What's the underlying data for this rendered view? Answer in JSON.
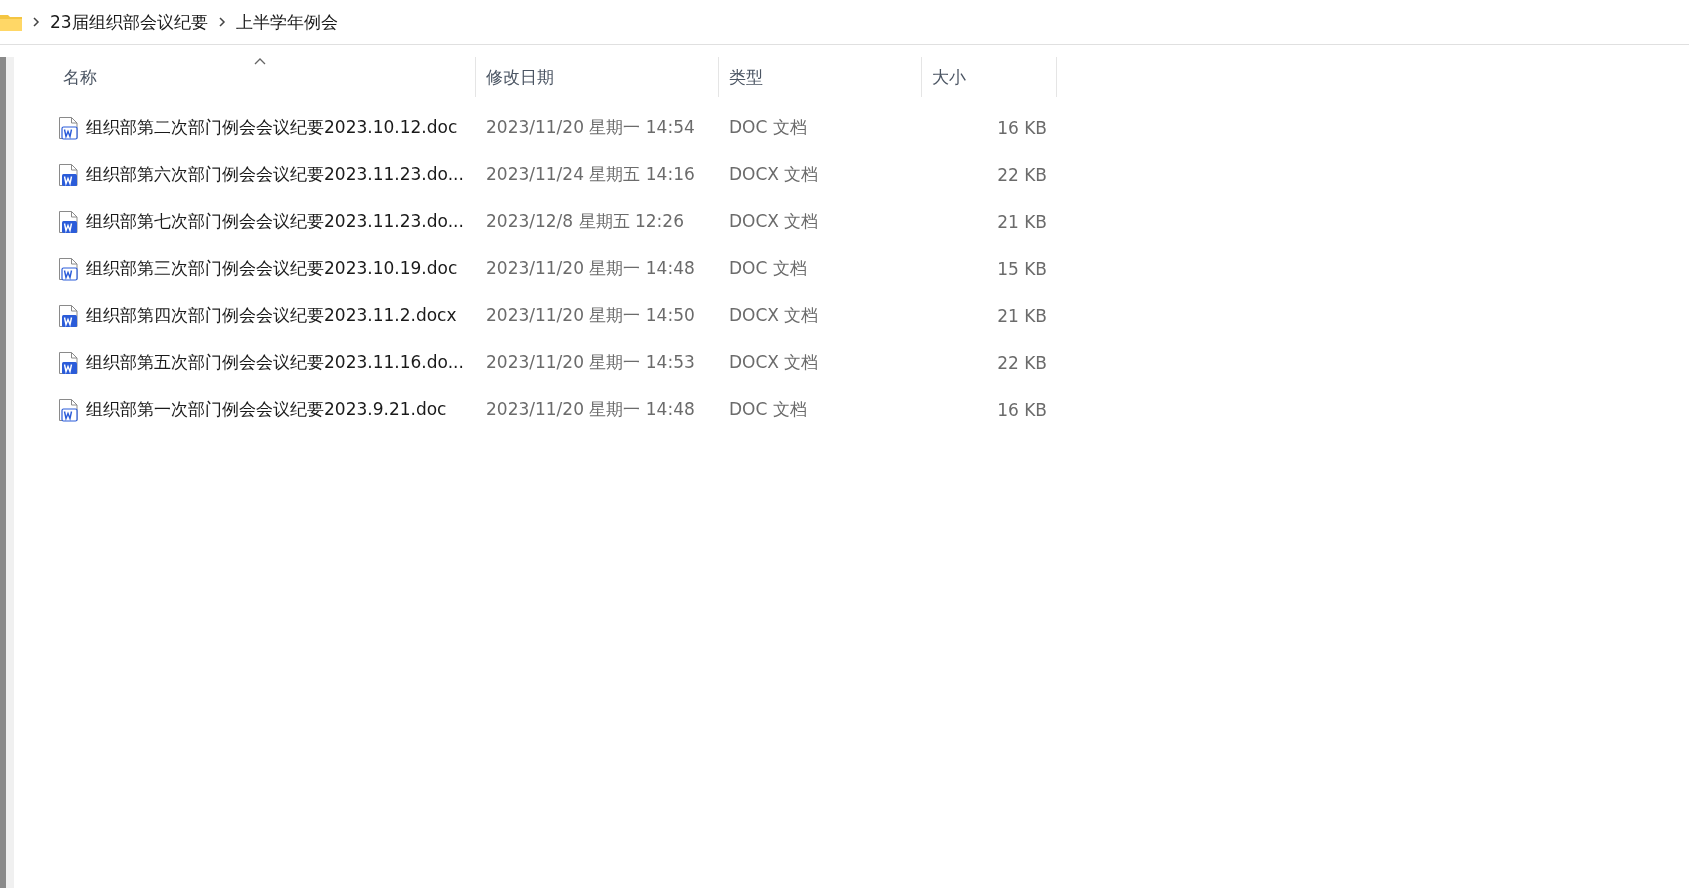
{
  "breadcrumb": [
    "23届组织部会议纪要",
    "上半学年例会"
  ],
  "table": {
    "columns": [
      "名称",
      "修改日期",
      "类型",
      "大小"
    ],
    "rows": [
      {
        "kind": "doc",
        "name": "组织部第二次部门例会会议纪要2023.10.12.doc",
        "date": "2023/11/20 星期一 14:54",
        "type": "DOC 文档",
        "size": "16 KB"
      },
      {
        "kind": "docx",
        "name": "组织部第六次部门例会会议纪要2023.11.23.do...",
        "date": "2023/11/24 星期五 14:16",
        "type": "DOCX 文档",
        "size": "22 KB"
      },
      {
        "kind": "docx",
        "name": "组织部第七次部门例会会议纪要2023.11.23.do...",
        "date": "2023/12/8 星期五 12:26",
        "type": "DOCX 文档",
        "size": "21 KB"
      },
      {
        "kind": "doc",
        "name": "组织部第三次部门例会会议纪要2023.10.19.doc",
        "date": "2023/11/20 星期一 14:48",
        "type": "DOC 文档",
        "size": "15 KB"
      },
      {
        "kind": "docx",
        "name": "组织部第四次部门例会会议纪要2023.11.2.docx",
        "date": "2023/11/20 星期一 14:50",
        "type": "DOCX 文档",
        "size": "21 KB"
      },
      {
        "kind": "docx",
        "name": "组织部第五次部门例会会议纪要2023.11.16.do...",
        "date": "2023/11/20 星期一 14:53",
        "type": "DOCX 文档",
        "size": "22 KB"
      },
      {
        "kind": "doc",
        "name": "组织部第一次部门例会会议纪要2023.9.21.doc",
        "date": "2023/11/20 星期一 14:48",
        "type": "DOC 文档",
        "size": "16 KB"
      }
    ]
  }
}
